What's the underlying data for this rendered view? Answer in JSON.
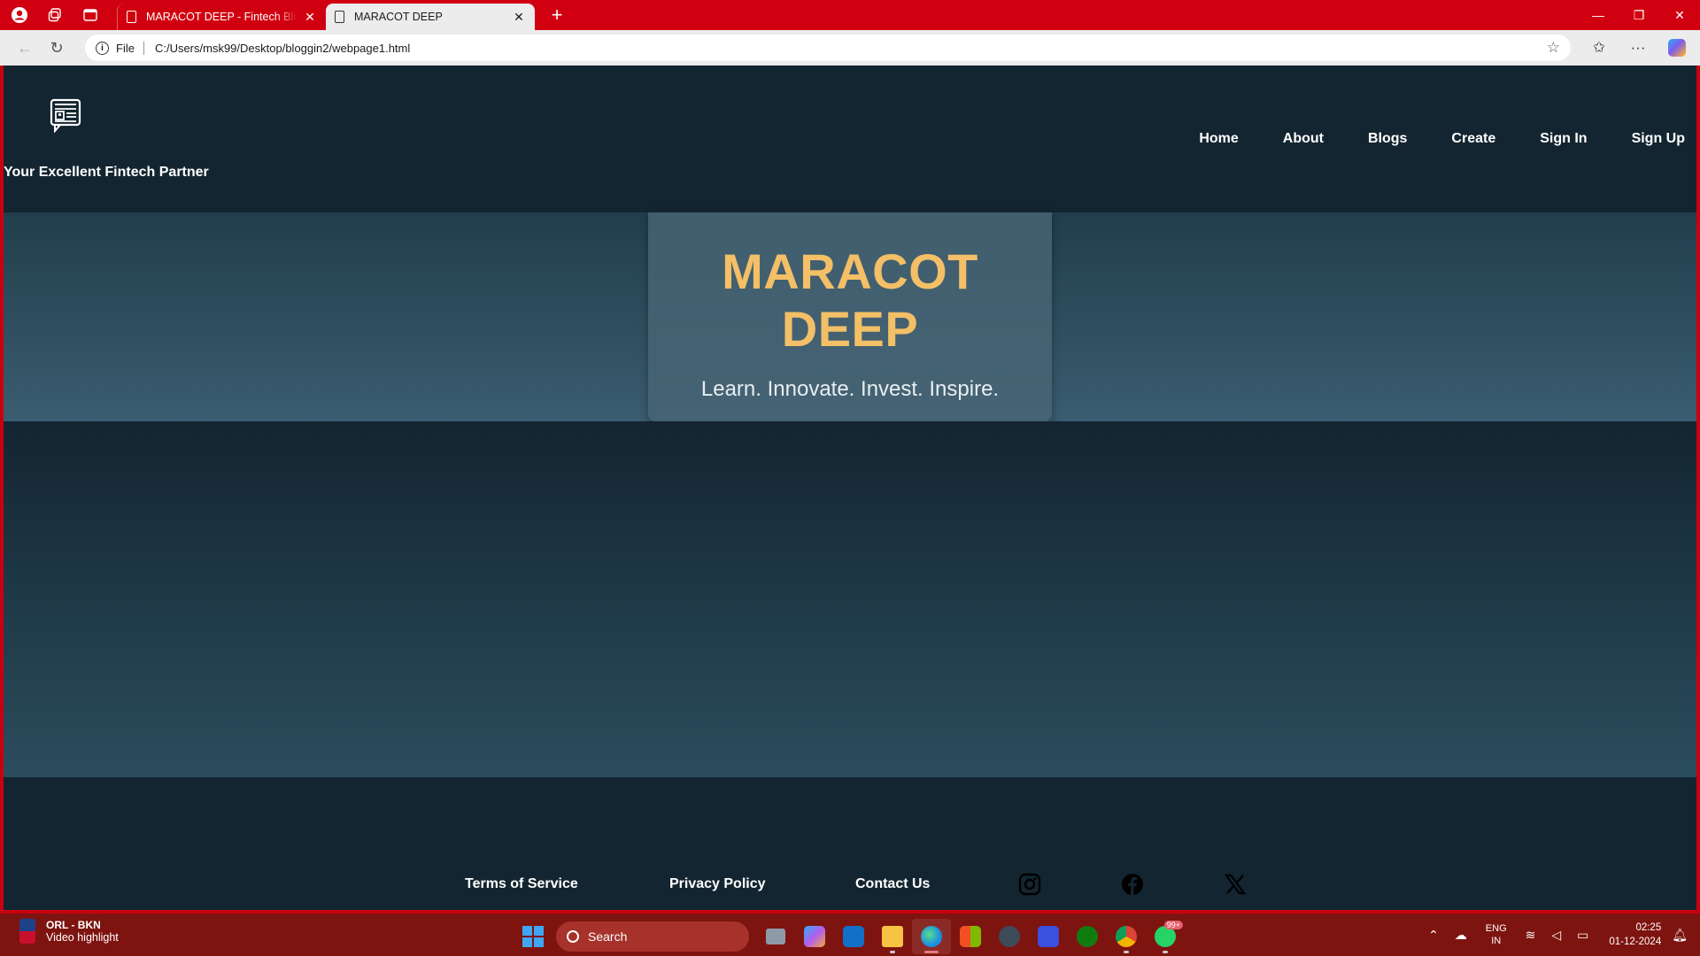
{
  "browser": {
    "tabs": [
      {
        "title": "MARACOT DEEP - Fintech Bloggin",
        "active": false
      },
      {
        "title": "MARACOT DEEP",
        "active": true
      }
    ],
    "address": {
      "scheme": "File",
      "url": "C:/Users/msk99/Desktop/bloggin2/webpage1.html"
    }
  },
  "site": {
    "tagline": "Your Excellent Fintech Partner",
    "nav": [
      "Home",
      "About",
      "Blogs",
      "Create",
      "Sign In",
      "Sign Up"
    ],
    "hero": {
      "title": "MARACOT DEEP",
      "subtitle": "Learn. Innovate. Invest. Inspire."
    },
    "footer": {
      "links": [
        "Terms of Service",
        "Privacy Policy",
        "Contact Us"
      ],
      "social": [
        "instagram-icon",
        "facebook-icon",
        "x-icon"
      ]
    },
    "colors": {
      "accent": "#f3bf67",
      "background": "#132530"
    }
  },
  "taskbar": {
    "news": {
      "title": "ORL - BKN",
      "subtitle": "Video highlight"
    },
    "search_label": "Search",
    "whatsapp_badge": "99+",
    "lang": [
      "ENG",
      "IN"
    ],
    "time": "02:25",
    "date": "01-12-2024"
  }
}
